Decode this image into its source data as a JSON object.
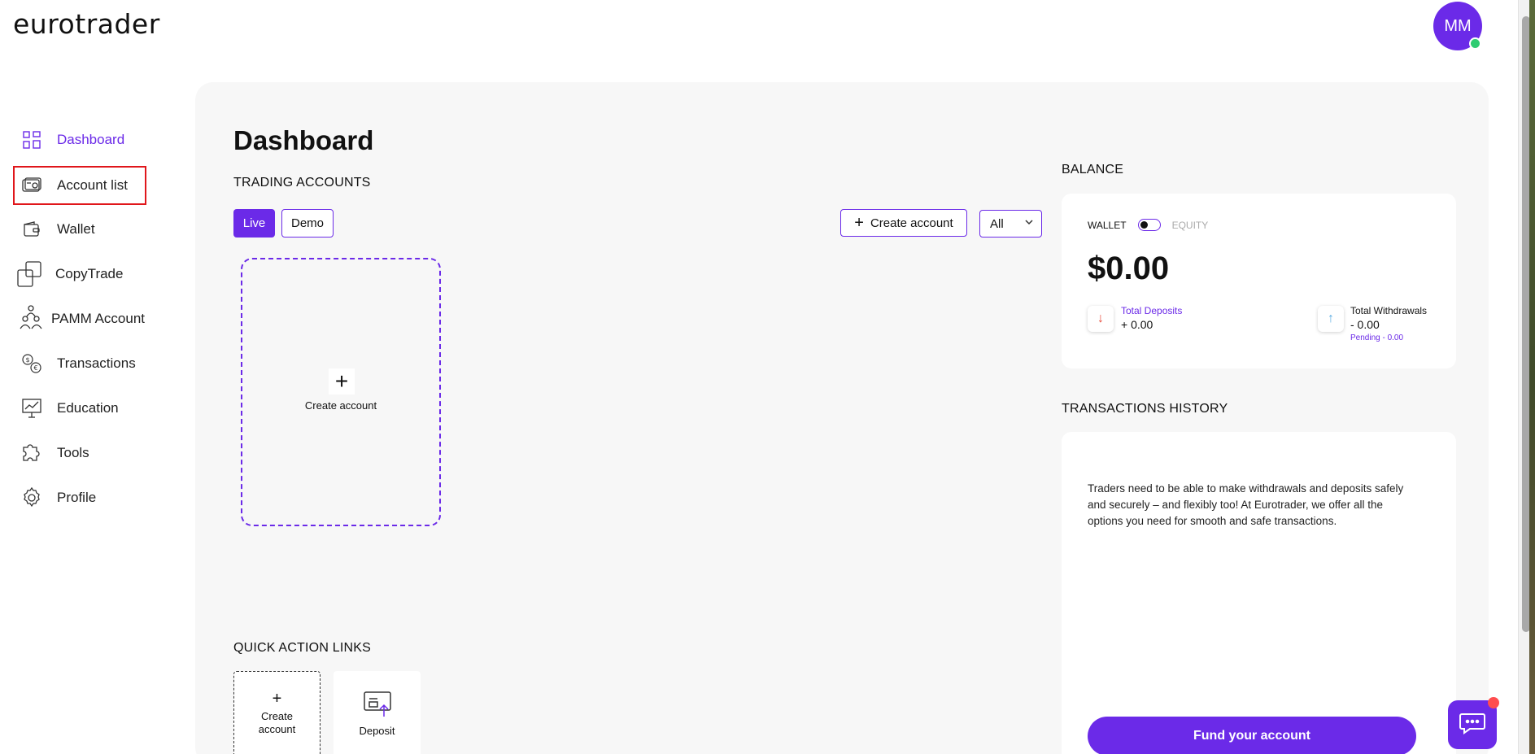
{
  "app": {
    "logo": "eurotrader",
    "avatar_initials": "MM"
  },
  "sidebar": {
    "items": [
      {
        "label": "Dashboard",
        "icon": "grid-icon",
        "active": true
      },
      {
        "label": "Account list",
        "icon": "card-icon",
        "highlighted": true
      },
      {
        "label": "Wallet",
        "icon": "wallet-icon"
      },
      {
        "label": "CopyTrade",
        "icon": "copy-icon"
      },
      {
        "label": "PAMM Account",
        "icon": "users-icon"
      },
      {
        "label": "Transactions",
        "icon": "currency-exchange-icon"
      },
      {
        "label": "Education",
        "icon": "presentation-icon"
      },
      {
        "label": "Tools",
        "icon": "puzzle-icon"
      },
      {
        "label": "Profile",
        "icon": "gear-icon"
      }
    ]
  },
  "main": {
    "title": "Dashboard",
    "trading_accounts": {
      "heading": "TRADING ACCOUNTS",
      "tabs": [
        "Live",
        "Demo"
      ],
      "active_tab": "Live",
      "create_button": "Create account",
      "filter_value": "All",
      "create_card_label": "Create account"
    },
    "quick_actions": {
      "heading": "QUICK ACTION LINKS",
      "items": [
        {
          "label_line1": "Create",
          "label_line2": "account"
        },
        {
          "label": "Deposit"
        }
      ]
    },
    "balance": {
      "heading": "BALANCE",
      "wallet_label": "WALLET",
      "equity_label": "EQUITY",
      "amount": "$0.00",
      "deposits_label": "Total Deposits",
      "deposits_value": "+ 0.00",
      "withdrawals_label": "Total Withdrawals",
      "withdrawals_value": "- 0.00",
      "pending": "Pending - 0.00"
    },
    "transactions_history": {
      "heading": "TRANSACTIONS HISTORY",
      "description": "Traders need to be able to make withdrawals and deposits safely and securely – and flexibly too! At Eurotrader, we offer all the options you need for smooth and safe transactions.",
      "fund_button": "Fund your account"
    }
  },
  "colors": {
    "accent": "#6b2ae8",
    "online": "#2ecc71",
    "highlight_border": "#e0161b"
  }
}
